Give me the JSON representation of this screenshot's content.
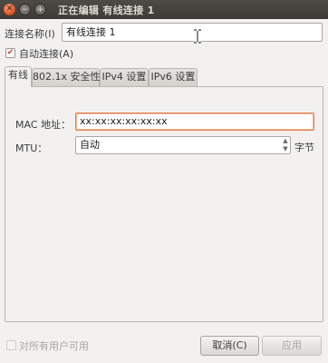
{
  "window": {
    "title": "正在编辑 有线连接 1",
    "close_glyph": "✕",
    "minimize_glyph": "−",
    "maximize_glyph": "+"
  },
  "connection_name": {
    "label": "连接名称(I)",
    "value": "有线连接 1"
  },
  "auto_connect": {
    "label": "自动连接(A)",
    "checked": true,
    "check_glyph": "✔"
  },
  "tabs": [
    {
      "label": "有线",
      "active": true
    },
    {
      "label": "802.1x 安全性",
      "active": false
    },
    {
      "label": "IPv4 设置",
      "active": false
    },
    {
      "label": "IPv6 设置",
      "active": false
    }
  ],
  "wired": {
    "mac_label": "MAC 地址：",
    "mac_value": "xx:xx:xx:xx:xx:xx",
    "mtu_label": "MTU：",
    "mtu_value": "自动",
    "mtu_unit": "字节",
    "spin_up": "▲",
    "spin_down": "▼"
  },
  "all_users": {
    "label": "对所有用户可用",
    "checked": false
  },
  "buttons": {
    "cancel": "取消(C)",
    "apply": "应用"
  },
  "colors": {
    "titlebar": "#3c3b37",
    "focus_border": "#e07f4d",
    "window_bg": "#f2f1f0"
  }
}
